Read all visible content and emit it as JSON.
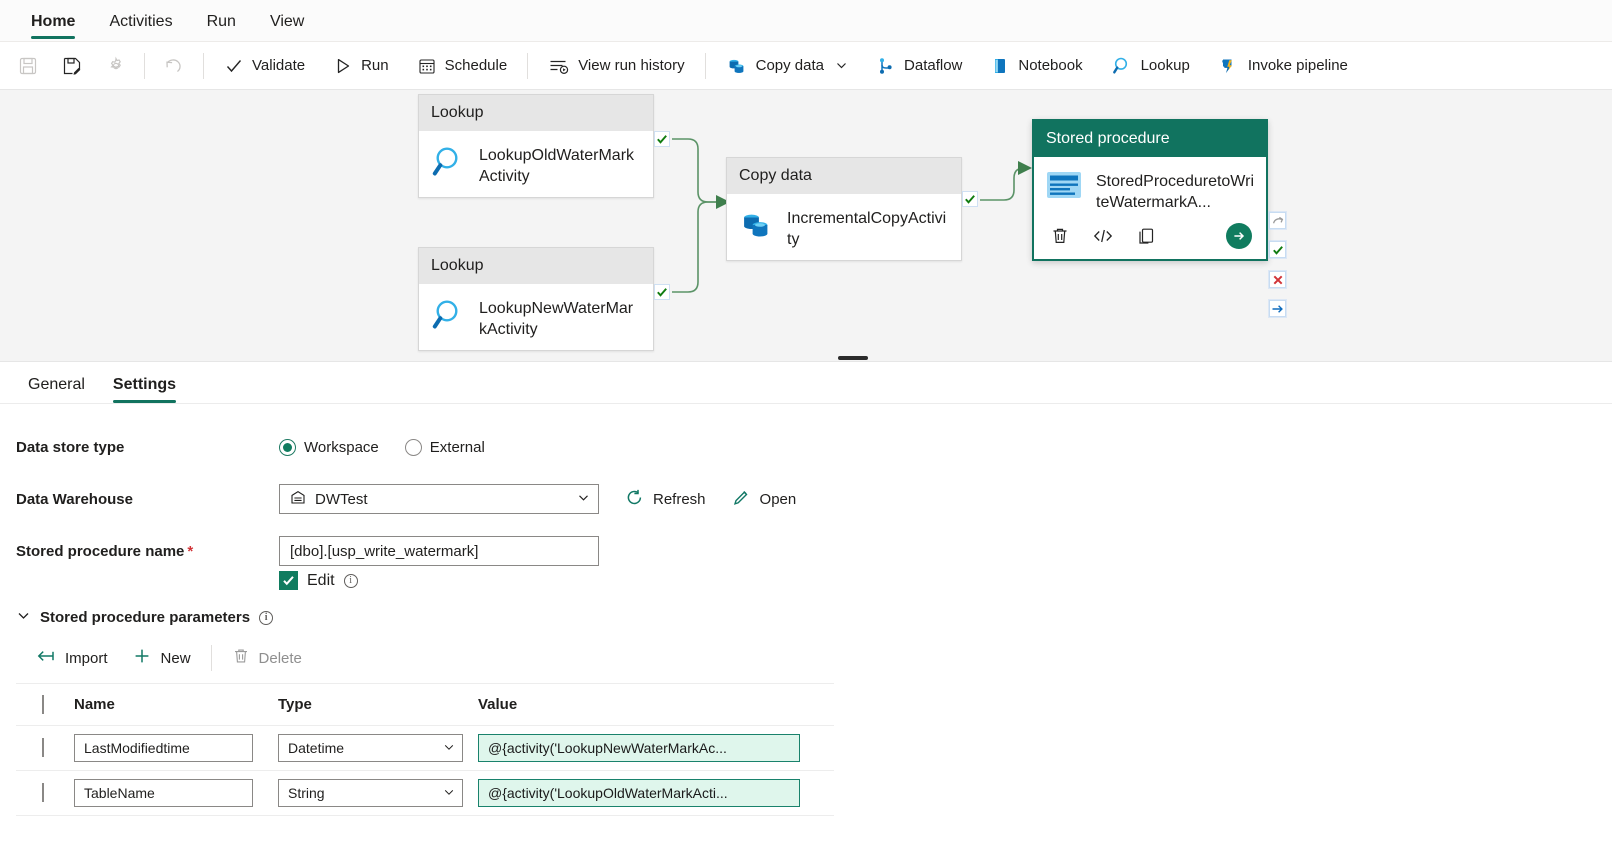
{
  "ribbon": {
    "tabs": [
      {
        "label": "Home",
        "active": true
      },
      {
        "label": "Activities",
        "active": false
      },
      {
        "label": "Run",
        "active": false
      },
      {
        "label": "View",
        "active": false
      }
    ]
  },
  "commandbar": {
    "items": [
      {
        "name": "save-button",
        "label": "",
        "icon": "save-icon",
        "disabled": true
      },
      {
        "name": "save-as-button",
        "label": "",
        "icon": "save-edit-icon",
        "disabled": false
      },
      {
        "name": "settings-button",
        "label": "",
        "icon": "gear-icon",
        "disabled": true
      },
      {
        "name": "undo-button",
        "label": "",
        "icon": "undo-icon",
        "disabled": true
      },
      {
        "name": "validate-button",
        "label": "Validate",
        "icon": "checkmark-icon",
        "disabled": false
      },
      {
        "name": "run-button",
        "label": "Run",
        "icon": "play-icon",
        "disabled": false
      },
      {
        "name": "schedule-button",
        "label": "Schedule",
        "icon": "calendar-icon",
        "disabled": false
      },
      {
        "name": "view-run-history-button",
        "label": "View run history",
        "icon": "history-icon",
        "disabled": false
      },
      {
        "name": "copy-data-button",
        "label": "Copy data",
        "icon": "copy-data-icon",
        "disabled": false
      },
      {
        "name": "dataflow-button",
        "label": "Dataflow",
        "icon": "dataflow-icon",
        "disabled": false
      },
      {
        "name": "notebook-button",
        "label": "Notebook",
        "icon": "notebook-icon",
        "disabled": false
      },
      {
        "name": "lookup-button",
        "label": "Lookup",
        "icon": "magnifier-icon",
        "disabled": false
      },
      {
        "name": "invoke-pipeline-button",
        "label": "Invoke pipeline",
        "icon": "invoke-pipeline-icon",
        "disabled": false
      }
    ]
  },
  "canvas": {
    "nodes": [
      {
        "type": "Lookup",
        "title": "LookupOldWaterMarkActivity",
        "selected": false
      },
      {
        "type": "Lookup",
        "title": "LookupNewWaterMarkActivity",
        "selected": false
      },
      {
        "type": "Copy data",
        "title": "IncrementalCopyActivity",
        "selected": false
      },
      {
        "type": "Stored procedure",
        "title": "StoredProceduretoWriteWatermarkA...",
        "selected": true
      }
    ],
    "selected_node_actions": [
      {
        "name": "delete-activity-button",
        "icon": "trash-icon"
      },
      {
        "name": "view-code-button",
        "icon": "code-icon"
      },
      {
        "name": "clone-activity-button",
        "icon": "copy-icon"
      },
      {
        "name": "add-output-button",
        "icon": "arrow-right-circle-icon"
      }
    ],
    "selected_node_statuses": [
      {
        "name": "on-skip-dependency",
        "icon": "skip-arrow-icon",
        "color": "#8a8a8a"
      },
      {
        "name": "on-success-dependency",
        "icon": "check-icon",
        "color": "#107c10"
      },
      {
        "name": "on-failure-dependency",
        "icon": "cross-icon",
        "color": "#d13438"
      },
      {
        "name": "on-completion-dependency",
        "icon": "arrow-right-icon",
        "color": "#0f6cbd"
      }
    ],
    "edge_status_icon": "check-icon"
  },
  "panel": {
    "tabs": [
      {
        "label": "General",
        "active": false
      },
      {
        "label": "Settings",
        "active": true
      }
    ],
    "data_store_type": {
      "label": "Data store type",
      "options": [
        {
          "label": "Workspace",
          "selected": true
        },
        {
          "label": "External",
          "selected": false
        }
      ]
    },
    "data_warehouse": {
      "label": "Data Warehouse",
      "value": "DWTest",
      "icon": "warehouse-icon",
      "refresh_label": "Refresh",
      "open_label": "Open"
    },
    "stored_procedure_name": {
      "label": "Stored procedure name",
      "required_marker": "*",
      "value": "[dbo].[usp_write_watermark]",
      "edit_label": "Edit",
      "edit_checked": true
    },
    "parameters_section": {
      "title": "Stored procedure parameters",
      "expanded": true,
      "toolbar": [
        {
          "name": "import-parameters-button",
          "label": "Import",
          "icon": "import-arrow-icon"
        },
        {
          "name": "new-parameter-button",
          "label": "New",
          "icon": "plus-icon"
        },
        {
          "name": "delete-parameter-button",
          "label": "Delete",
          "icon": "trash-icon"
        }
      ],
      "columns": [
        "Name",
        "Type",
        "Value"
      ],
      "rows": [
        {
          "selected": false,
          "name": "LastModifiedtime",
          "type": "Datetime",
          "value": "@{activity('LookupNewWaterMarkAc..."
        },
        {
          "selected": false,
          "name": "TableName",
          "type": "String",
          "value": "@{activity('LookupOldWaterMarkActi..."
        }
      ]
    }
  },
  "colors": {
    "accent": "#11735f",
    "selected_node_header": "#11735f",
    "success": "#107c10",
    "error": "#d13438",
    "info": "#0f6cbd",
    "expression_field_bg": "#dff6ec",
    "expression_field_border": "#19826c"
  }
}
